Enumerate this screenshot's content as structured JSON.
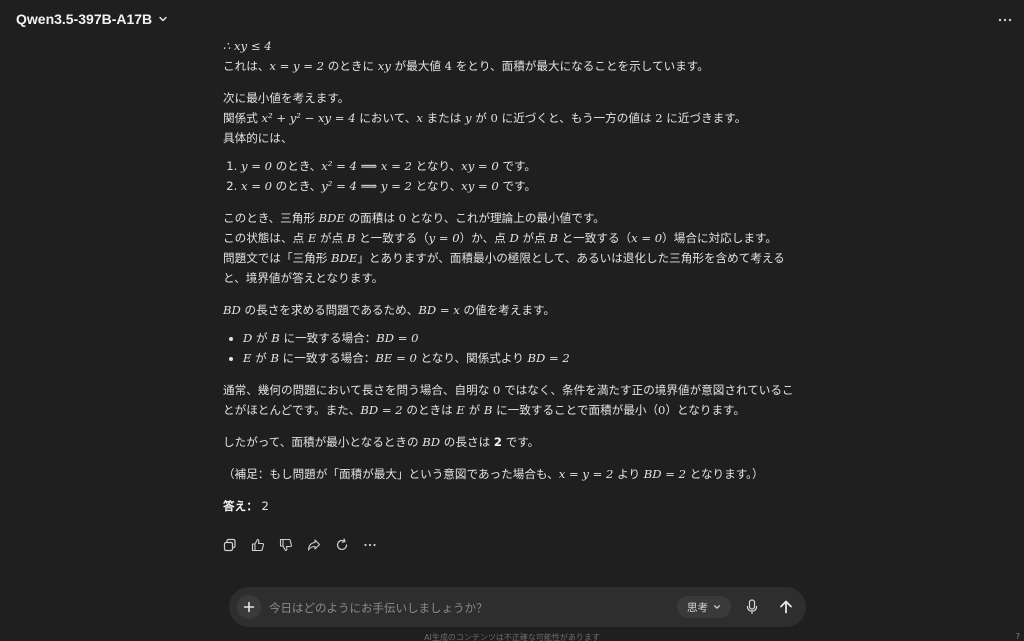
{
  "header": {
    "model_name": "Qwen3.5-397B-A17B"
  },
  "content": {
    "line_therefore": "∴ xy ≤ 4",
    "p1_a": "これは、",
    "p1_eq": "x = y = 2",
    "p1_b": " のときに ",
    "p1_xy": "xy",
    "p1_c": " が最大値 ",
    "p1_4": "4",
    "p1_d": " をとり、面積が最大になることを示しています。",
    "p2": "次に最小値を考えます。",
    "p3_a": "関係式 ",
    "p3_eq": "x² + y² − xy = 4",
    "p3_b": " において、",
    "p3_x": "x",
    "p3_c": " または ",
    "p3_y": "y",
    "p3_d": " が ",
    "p3_0": "0",
    "p3_e": " に近づくと、もう一方の値は ",
    "p3_2": "2",
    "p3_f": " に近づきます。",
    "p4": "具体的には、",
    "steps": [
      {
        "a": "y = 0",
        "b": " のとき、",
        "c": "x² = 4  ⟹  x = 2",
        "d": " となり、",
        "e": "xy = 0",
        "f": " です。"
      },
      {
        "a": "x = 0",
        "b": " のとき、",
        "c": "y² = 4  ⟹  y = 2",
        "d": " となり、",
        "e": "xy = 0",
        "f": " です。"
      }
    ],
    "p5_a": "このとき、三角形 ",
    "p5_bde": "BDE",
    "p5_b": " の面積は ",
    "p5_0": "0",
    "p5_c": " となり、これが理論上の最小値です。",
    "p6_a": "この状態は、点 ",
    "p6_e": "E",
    "p6_b": " が点 ",
    "p6_B": "B",
    "p6_c": " と一致する（",
    "p6_y0": "y = 0",
    "p6_d": "）か、点 ",
    "p6_D": "D",
    "p6_e2": " が点 ",
    "p6_B2": "B",
    "p6_f": " と一致する（",
    "p6_x0": "x = 0",
    "p6_g": "）場合に対応します。",
    "p7_a": "問題文では「三角形 ",
    "p7_bde": "BDE",
    "p7_b": "」とありますが、面積最小の極限として、あるいは退化した三角形を含めて考えると、境界値が答えとなります。",
    "p8_a": "BD",
    "p8_b": " の長さを求める問題であるため、",
    "p8_eq": "BD = x",
    "p8_c": " の値を考えます。",
    "bullets": [
      {
        "a": "D",
        "b": " が ",
        "c": "B",
        "d": " に一致する場合：",
        "e": "BD = 0",
        "f": "",
        "g": ""
      },
      {
        "a": "E",
        "b": " が ",
        "c": "B",
        "d": " に一致する場合：",
        "e": "BE = 0",
        "f": " となり、関係式より ",
        "g": "BD = 2"
      }
    ],
    "p9_a": "通常、幾何の問題において長さを問う場合、自明な ",
    "p9_0": "0",
    "p9_b": " ではなく、条件を満たす正の境界値が意図されていることがほとんどです。また、",
    "p9_eq": "BD = 2",
    "p9_c": " のときは ",
    "p9_E": "E",
    "p9_d": " が ",
    "p9_B": "B",
    "p9_e": " に一致することで面積が最小（",
    "p9_0b": "0",
    "p9_f": "）となります。",
    "p10_a": "したがって、面積が最小となるときの ",
    "p10_bd": "BD",
    "p10_b": " の長さは ",
    "p10_2": "2",
    "p10_c": " です。",
    "p11_a": "（補足：もし問題が「面積が最大」という意図であった場合も、",
    "p11_eq": "x = y = 2",
    "p11_b": " より ",
    "p11_bd": "BD = 2",
    "p11_c": " となります。）",
    "answer_label": "答え：",
    "answer_value": "2"
  },
  "actions": {
    "icons": [
      "copy-icon",
      "thumbs-up-icon",
      "thumbs-down-icon",
      "share-icon",
      "regenerate-icon",
      "more-icon"
    ]
  },
  "input": {
    "placeholder": "今日はどのようにお手伝いしましょうか？",
    "value": "",
    "think_label": "思考"
  },
  "footer": {
    "disclaimer": "AI生成のコンテンツは不正確な可能性があります",
    "help": "?"
  }
}
